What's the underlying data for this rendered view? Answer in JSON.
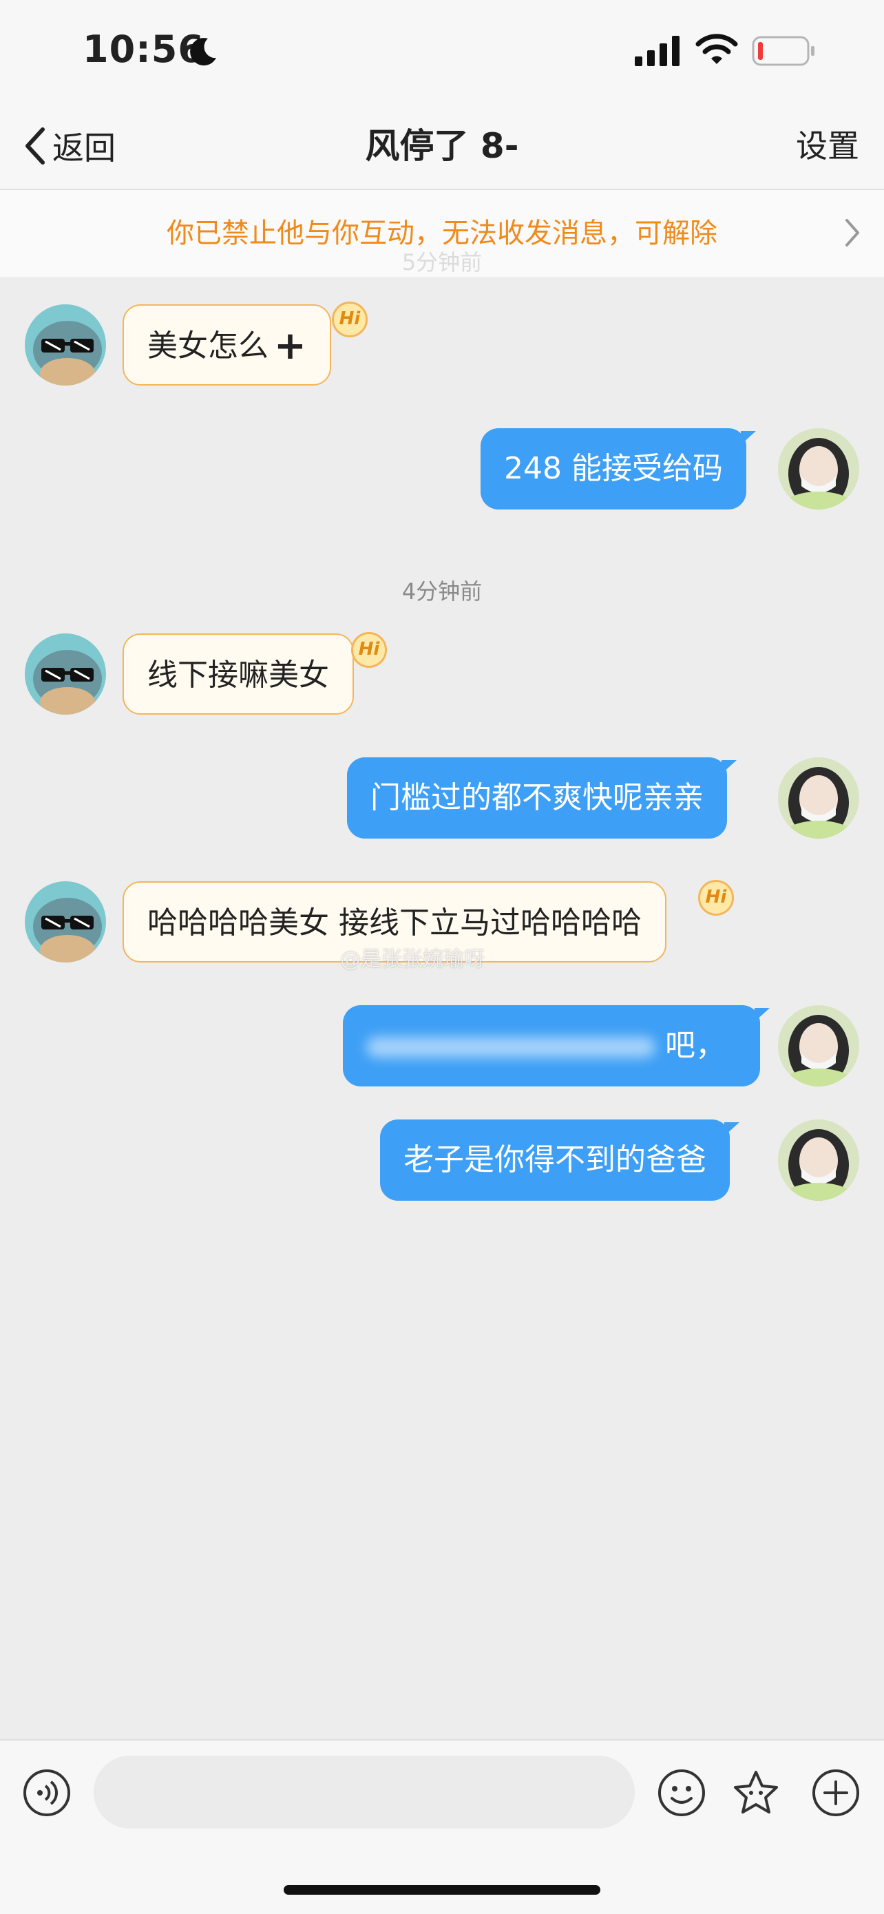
{
  "status_bar": {
    "time": "10:56"
  },
  "nav": {
    "back_label": "返回",
    "title": "风停了 8-",
    "settings_label": "设置"
  },
  "notice": {
    "text": "你已禁止他与你互动，无法收发消息，可解除",
    "faded_timestamp": "5分钟前"
  },
  "messages": [
    {
      "side": "in",
      "text": "美女怎么",
      "has_plus": true,
      "badge": "Hi"
    },
    {
      "side": "out",
      "text": "248 能接受给码"
    },
    {
      "type": "timestamp",
      "text": "4分钟前"
    },
    {
      "side": "in",
      "text": "线下接嘛美女",
      "badge": "Hi"
    },
    {
      "side": "out",
      "text": "门槛过的都不爽快呢亲亲"
    },
    {
      "side": "in",
      "text": "哈哈哈哈美女 接线下立马过哈哈哈哈",
      "badge": "Hi"
    },
    {
      "side": "out",
      "text": "吧，",
      "blurred": true
    },
    {
      "side": "out",
      "text": "老子是你得不到的爸爸"
    }
  ],
  "watermark": "@是张张婉瑜呀",
  "input": {
    "placeholder": ""
  },
  "colors": {
    "accent": "#3d9ff5",
    "notice": "#f08a1a",
    "bubble_in_border": "#f5b55a",
    "bubble_in_bg": "#fffbf0"
  },
  "icons": [
    "moon-icon",
    "signal-icon",
    "wifi-icon",
    "battery-icon",
    "back-chevron-icon",
    "chevron-right-icon",
    "voice-icon",
    "emoji-icon",
    "sticker-icon",
    "plus-icon",
    "turtle-avatar",
    "user-avatar"
  ]
}
